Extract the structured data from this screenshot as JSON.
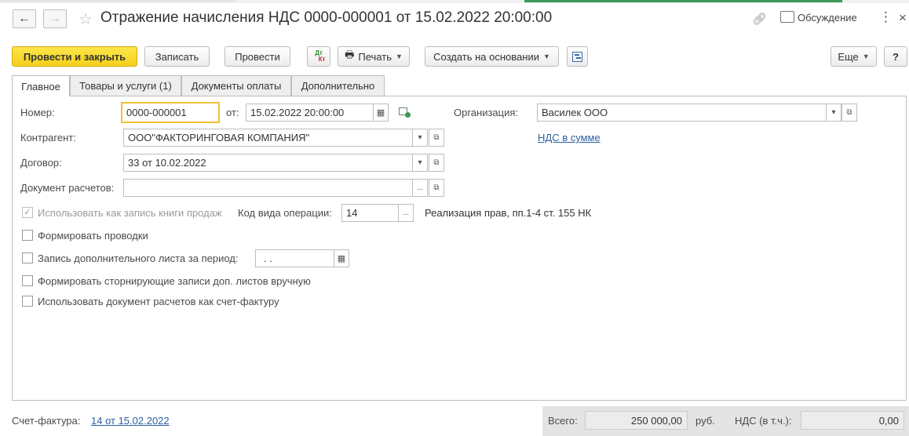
{
  "window": {
    "title": "Отражение начисления НДС 0000-000001 от 15.02.2022 20:00:00",
    "discussion_label": "Обсуждение"
  },
  "toolbar": {
    "post_close": "Провести и закрыть",
    "save": "Записать",
    "post": "Провести",
    "dtkt_top": "Дт",
    "dtkt_bottom": "Кт",
    "print": "Печать",
    "create_based": "Создать на основании",
    "more": "Еще",
    "help": "?"
  },
  "tabs": [
    {
      "label": "Главное",
      "active": true
    },
    {
      "label": "Товары и услуги (1)"
    },
    {
      "label": "Документы оплаты"
    },
    {
      "label": "Дополнительно"
    }
  ],
  "form": {
    "number_label": "Номер:",
    "number_value": "0000-000001",
    "from_label": "от:",
    "date_value": "15.02.2022 20:00:00",
    "org_label": "Организация:",
    "org_value": "Василек ООО",
    "counterparty_label": "Контрагент:",
    "counterparty_value": "ООО\"ФАКТОРИНГОВАЯ КОМПАНИЯ\"",
    "vat_in_amount_link": "НДС в сумме",
    "contract_label": "Договор:",
    "contract_value": "33 от 10.02.2022",
    "settlement_doc_label": "Документ расчетов:",
    "settlement_doc_value": "",
    "use_sales_book_label": "Использовать как запись книги продаж",
    "op_code_label": "Код вида операции:",
    "op_code_value": "14",
    "op_code_desc": "Реализация прав, пп.1-4 ст. 155 НК",
    "make_entries_label": "Формировать проводки",
    "additional_sheet_label": "Запись дополнительного листа за период:",
    "additional_sheet_value": " .  .",
    "storno_label": "Формировать сторнирующие записи доп. листов вручную",
    "use_as_invoice_label": "Использовать документ расчетов как счет-фактуру"
  },
  "footer": {
    "invoice_label": "Счет-фактура:",
    "invoice_link": "14 от 15.02.2022",
    "total_label": "Всего:",
    "total_value": "250 000,00",
    "currency": "руб.",
    "vat_label": "НДС (в т.ч.):",
    "vat_value": "0,00"
  },
  "colors": {
    "accent_yellow": "#f6cf1a",
    "link_blue": "#2b5fa0",
    "strip_green": "#3a9a5a"
  }
}
